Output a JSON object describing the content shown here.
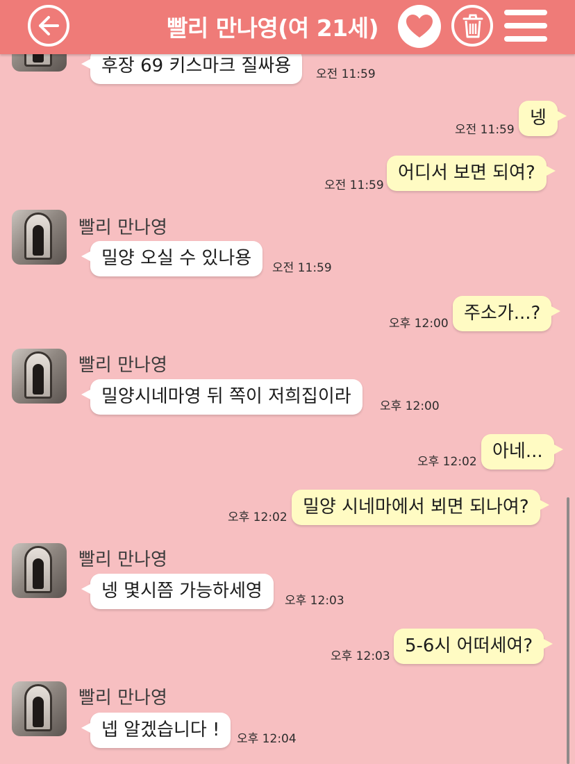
{
  "header": {
    "title": "빨리 만나영(여 21세)",
    "back_icon": "back-arrow-icon",
    "favorite_icon": "heart-icon",
    "delete_icon": "trash-icon",
    "menu_icon": "hamburger-menu-icon",
    "background": "#ef7b78"
  },
  "colors": {
    "chat_background": "#f7bfc1",
    "incoming_bubble": "#ffffff",
    "outgoing_bubble": "#fffbc3"
  },
  "messages": [
    {
      "direction": "in",
      "text": "후장 69 키스마크 질싸용",
      "time": "오전 11:59"
    },
    {
      "direction": "out",
      "text": "넹",
      "time": "오전 11:59"
    },
    {
      "direction": "out",
      "text": "어디서 보면 되여?",
      "time": "오전 11:59"
    },
    {
      "direction": "in",
      "sender": "빨리 만나영",
      "text": "밀양 오실 수 있나용",
      "time": "오전 11:59"
    },
    {
      "direction": "out",
      "text": "주소가...?",
      "time": "오후 12:00"
    },
    {
      "direction": "in",
      "sender": "빨리 만나영",
      "text": "밀양시네마영 뒤 쪽이 저희집이라",
      "time": "오후 12:00"
    },
    {
      "direction": "out",
      "text": "아네...",
      "time": "오후 12:02"
    },
    {
      "direction": "out",
      "text": "밀양 시네마에서 뵈면 되나여?",
      "time": "오후 12:02"
    },
    {
      "direction": "in",
      "sender": "빨리 만나영",
      "text": "넹 몇시쯤 가능하세영",
      "time": "오후 12:03"
    },
    {
      "direction": "out",
      "text": "5-6시 어떠세여?",
      "time": "오후 12:03"
    },
    {
      "direction": "in",
      "sender": "빨리 만나영",
      "text": "넵 알겠습니다 !",
      "time": "오후 12:04"
    }
  ]
}
